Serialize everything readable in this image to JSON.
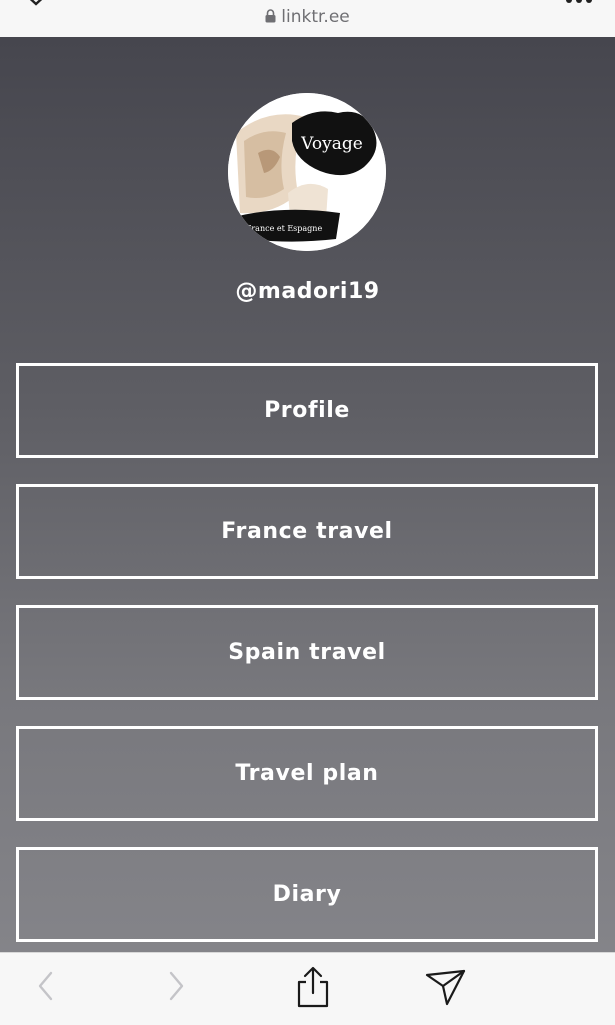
{
  "browser": {
    "url": "linktr.ee",
    "close_icon": "close-x-icon",
    "lock_icon": "lock-icon",
    "more_icon": "ellipsis-icon"
  },
  "profile": {
    "avatar_text_top": "Voyage",
    "avatar_text_bottom": "France et Espagne",
    "username": "@madori19"
  },
  "links": [
    {
      "label": "Profile"
    },
    {
      "label": "France travel"
    },
    {
      "label": "Spain travel"
    },
    {
      "label": "Travel plan"
    },
    {
      "label": "Diary"
    }
  ],
  "toolbar": {
    "back_icon": "chevron-left-icon",
    "forward_icon": "chevron-right-icon",
    "share_icon": "share-icon",
    "send_icon": "send-icon"
  },
  "colors": {
    "background_top": "#46464e",
    "background_bottom": "#848489",
    "button_border": "#ffffff",
    "text": "#ffffff"
  }
}
